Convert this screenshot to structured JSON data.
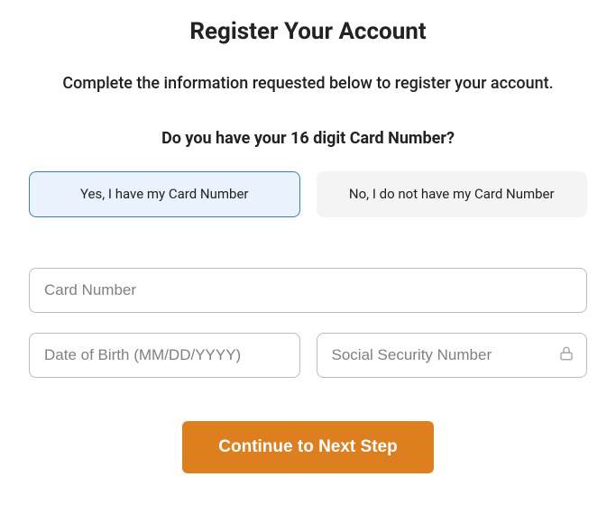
{
  "title": "Register Your Account",
  "instruction": "Complete the information requested below to register your account.",
  "question": "Do you have your 16 digit Card Number?",
  "options": {
    "yes": "Yes, I have my Card Number",
    "no": "No, I do not have my Card Number"
  },
  "fields": {
    "card_number": {
      "placeholder": "Card Number",
      "value": ""
    },
    "dob": {
      "placeholder": "Date of Birth (MM/DD/YYYY)",
      "value": ""
    },
    "ssn": {
      "placeholder": "Social Security Number",
      "value": ""
    }
  },
  "continue_label": "Continue to Next Step"
}
